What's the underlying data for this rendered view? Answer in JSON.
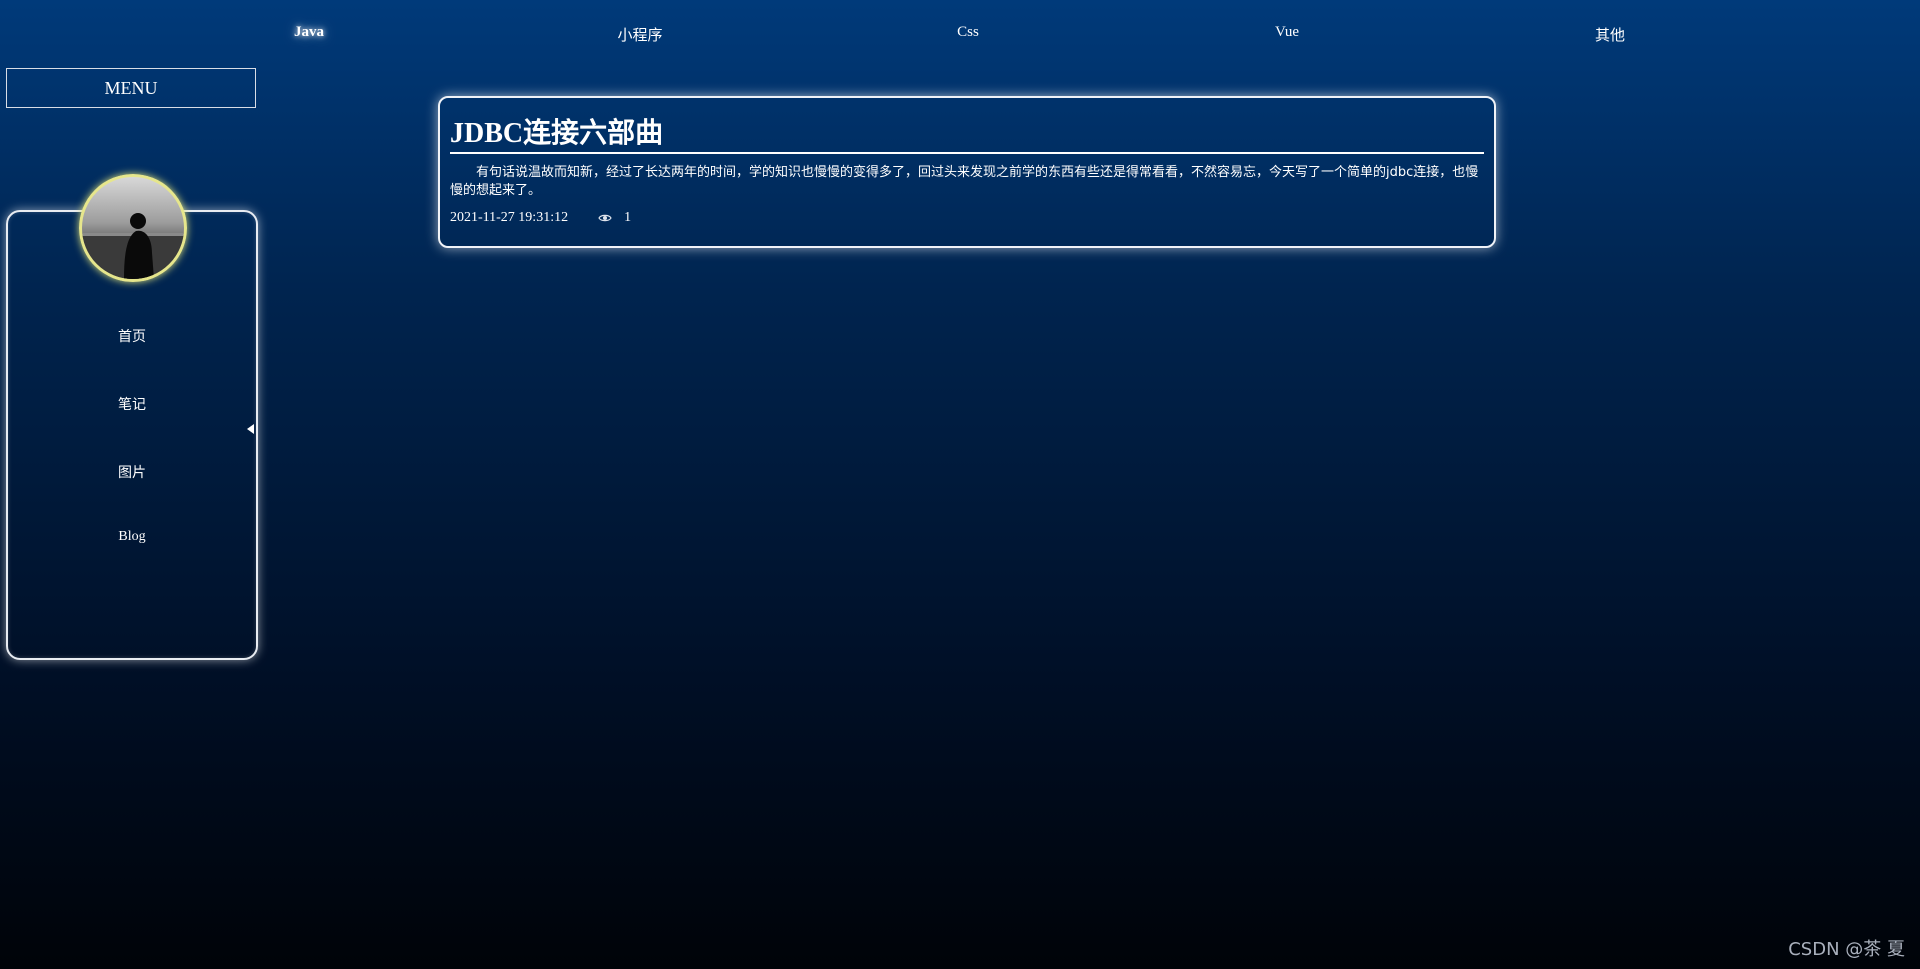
{
  "top_nav": {
    "items": [
      {
        "label": "Java"
      },
      {
        "label": "小程序"
      },
      {
        "label": "Css"
      },
      {
        "label": "Vue"
      },
      {
        "label": "其他"
      }
    ]
  },
  "sidebar": {
    "menu_label": "MENU",
    "items": [
      {
        "label": "首页"
      },
      {
        "label": "笔记"
      },
      {
        "label": "图片"
      },
      {
        "label": "Blog"
      }
    ]
  },
  "article": {
    "title": "JDBC连接六部曲",
    "summary": "有句话说温故而知新，经过了长达两年的时间，学的知识也慢慢的变得多了，回过头来发现之前学的东西有些还是得常看看，不然容易忘，今天写了一个简单的jdbc连接，也慢慢的想起来了。",
    "date": "2021-11-27 19:31:12",
    "views": "1"
  },
  "watermark": "CSDN @茶 夏",
  "colors": {
    "accent_glow": "#ffffff",
    "avatar_ring": "#e6e68c",
    "background_top": "#003a7a",
    "background_bottom": "#000308"
  },
  "icons": {
    "views": "eye-icon",
    "collapse": "caret-left-icon"
  }
}
